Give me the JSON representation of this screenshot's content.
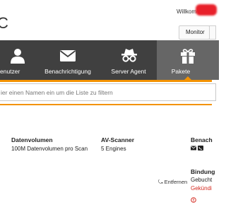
{
  "header": {
    "brand": "C",
    "welcome": "Willkom",
    "monitor_button": "Monitor"
  },
  "nav": {
    "items": [
      {
        "label": "enutzer",
        "icon": "user-icon"
      },
      {
        "label": "Benachrichtigung",
        "icon": "envelope-icon"
      },
      {
        "label": "Server Agent",
        "icon": "agent-icon"
      },
      {
        "label": "Pakete",
        "icon": "gift-icon",
        "active": true
      }
    ]
  },
  "filter": {
    "placeholder": "ier einen Namen ein um die Liste zu filtern"
  },
  "package": {
    "volume_header": "Datenvolumen",
    "volume_value": "100M Datenvolumen pro Scan",
    "scanner_header": "AV-Scanner",
    "scanner_value": "5 Engines",
    "notify_header": "Benach",
    "binding_header": "Bindung",
    "binding_value": "Gebucht",
    "binding_status": "Gekündi",
    "remove_label": "Entfernen"
  },
  "colors": {
    "accent": "#f39200",
    "navbar": "#404040",
    "active_tab": "#666666",
    "status_red": "#d42a20"
  }
}
